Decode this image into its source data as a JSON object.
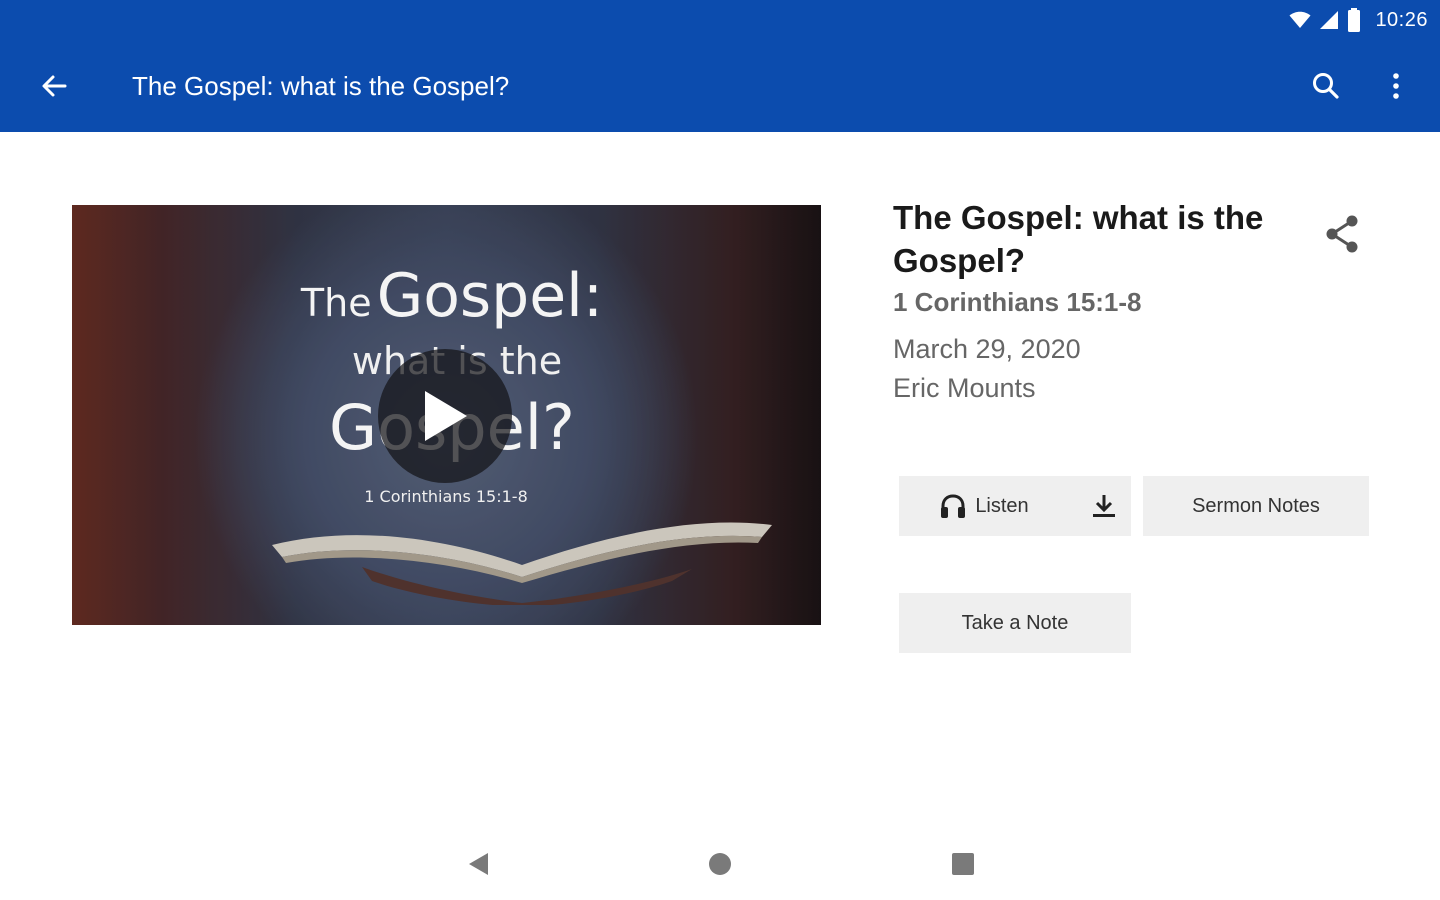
{
  "status_bar": {
    "time": "10:26",
    "icons": [
      "wifi-icon",
      "cell-signal-icon",
      "battery-icon"
    ]
  },
  "app_bar": {
    "title": "The Gospel: what is the Gospel?",
    "icons": [
      "back-arrow-icon",
      "search-icon",
      "more-vert-icon"
    ],
    "background": "#0c4cae"
  },
  "video": {
    "overlay_line1_small": "The",
    "overlay_line1_large": "Gospel:",
    "overlay_line2": "what is the",
    "overlay_line3": "Gospel?",
    "overlay_reference": "1 Corinthians 15:1-8",
    "play_icon": "play-icon"
  },
  "sermon": {
    "title": "The Gospel: what is the Gospel?",
    "passage": "1 Corinthians 15:1-8",
    "date": "March 29, 2020",
    "speaker": "Eric Mounts",
    "share_icon": "share-icon"
  },
  "actions": {
    "listen_label": "Listen",
    "listen_icon": "headphones-icon",
    "download_icon": "download-icon",
    "sermon_notes_label": "Sermon Notes",
    "take_note_label": "Take a Note"
  },
  "nav_bar": {
    "icons": [
      "nav-back-icon",
      "nav-home-icon",
      "nav-recents-icon"
    ]
  }
}
